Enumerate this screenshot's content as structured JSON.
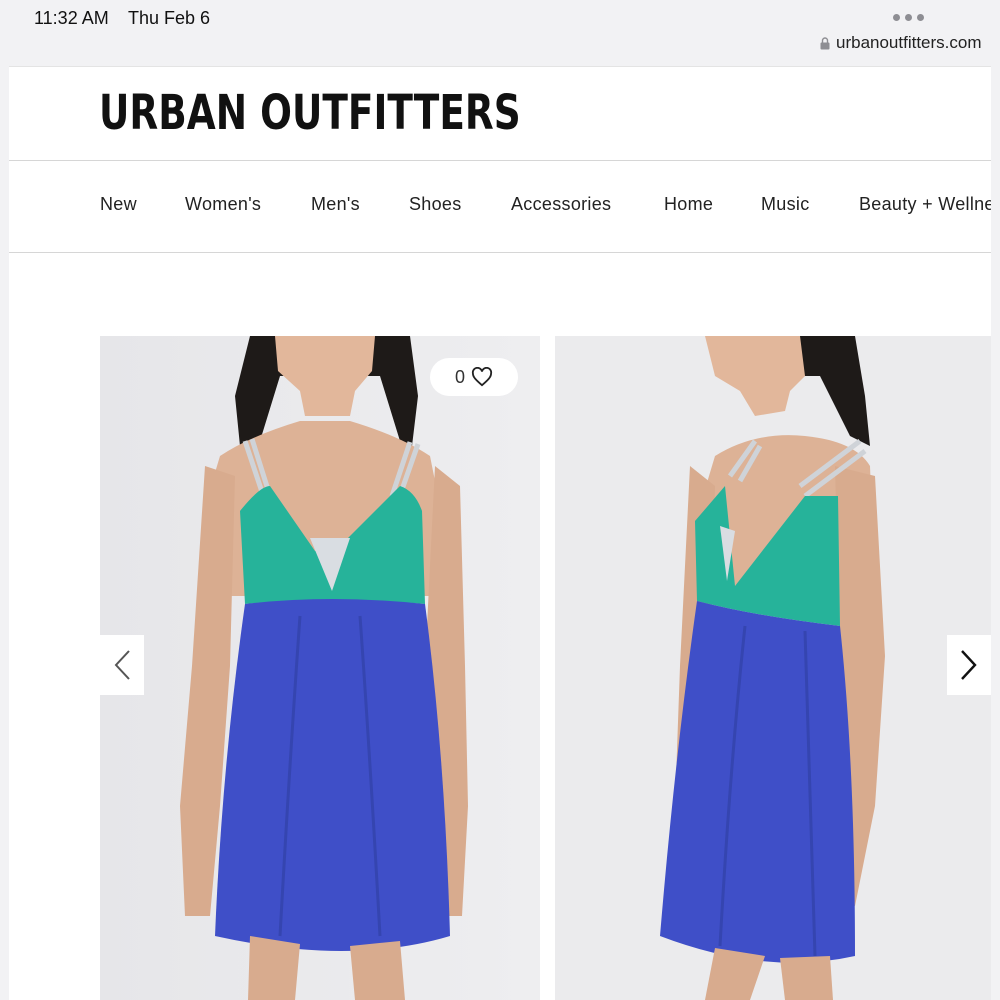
{
  "status_bar": {
    "time": "11:32 AM",
    "date": "Thu Feb 6"
  },
  "browser": {
    "url": "urbanoutfitters.com"
  },
  "site": {
    "logo": "URBAN OUTFITTERS"
  },
  "nav": {
    "items": [
      {
        "label": "New"
      },
      {
        "label": "Women's"
      },
      {
        "label": "Men's"
      },
      {
        "label": "Shoes"
      },
      {
        "label": "Accessories"
      },
      {
        "label": "Home"
      },
      {
        "label": "Music"
      },
      {
        "label": "Beauty + Wellness"
      }
    ]
  },
  "product": {
    "wishlist_count": "0",
    "images": [
      {
        "alt": "model-front-view",
        "dress_top_color": "#26b39a",
        "dress_skirt_color": "#3f4fc8",
        "strap_color": "#cfd3d8"
      },
      {
        "alt": "model-side-view",
        "dress_top_color": "#26b39a",
        "dress_skirt_color": "#3f4fc8",
        "strap_color": "#cfd3d8"
      }
    ]
  },
  "icons": {
    "prev": "chevron-left-icon",
    "next": "chevron-right-icon",
    "wishlist": "heart-icon",
    "lock": "lock-icon",
    "more": "more-dots-icon"
  }
}
